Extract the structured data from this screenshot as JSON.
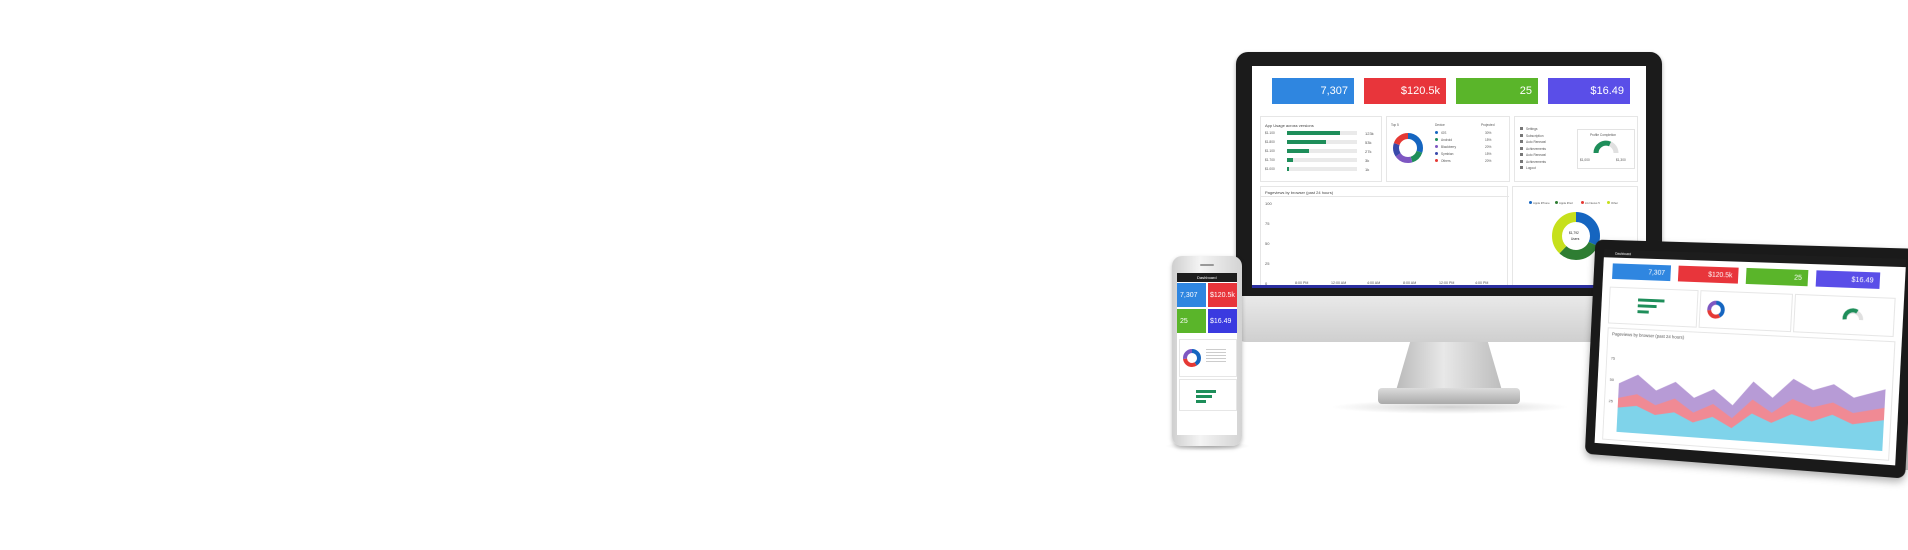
{
  "colors": {
    "blue": "#2f86e0",
    "red": "#e8353b",
    "green": "#5ab52a",
    "purple": "#5a4ee8",
    "bar_green": "#1e8e5a"
  },
  "monitor": {
    "tiles": [
      "7,307",
      "$120.5k",
      "25",
      "$16.49"
    ],
    "app_usage": {
      "title": "App Usage across versions",
      "rows": [
        {
          "label": "$1.100",
          "value": "123k",
          "fill": 0.75
        },
        {
          "label": "$1.800",
          "value": "53k",
          "fill": 0.55
        },
        {
          "label": "$1.100",
          "value": "27k",
          "fill": 0.32
        },
        {
          "label": "$1.700",
          "value": "3k",
          "fill": 0.08
        },
        {
          "label": "$1.000",
          "value": "1k",
          "fill": 0.03
        }
      ]
    },
    "platforms": {
      "headers": [
        "Top 5",
        "Device",
        "Projected"
      ],
      "rows": [
        {
          "name": "iOS",
          "value": "30%",
          "color": "#1565c0"
        },
        {
          "name": "Android",
          "value": "15%",
          "color": "#1e8e5a"
        },
        {
          "name": "Blackberry",
          "value": "20%",
          "color": "#7e57c2"
        },
        {
          "name": "Symbian",
          "value": "15%",
          "color": "#3949ab"
        },
        {
          "name": "Others",
          "value": "20%",
          "color": "#e53935"
        }
      ]
    },
    "settings_menu": [
      "Settings",
      "Subscription",
      "Auto Renewal",
      "Achievements",
      "Auto Renewal",
      "Achievements",
      "Logout"
    ],
    "profile": {
      "title": "Profile Completion",
      "min": "$1,000",
      "max": "$1,300"
    },
    "pageviews": {
      "title": "Pageviews by browser (past 24 hours)",
      "y_ticks": [
        "100",
        "75",
        "50",
        "25",
        "0"
      ],
      "x_ticks": [
        "8:00 PM",
        "12:00 AM",
        "4:00 AM",
        "8:00 AM",
        "12:00 PM",
        "4:00 PM"
      ]
    },
    "browser_donut": {
      "legend": [
        "Apple iPhone",
        "Apple iPad",
        "LG Nexus 5",
        "Other"
      ],
      "center_value": "$1,792",
      "center_label": "Users"
    }
  },
  "phone": {
    "header": "Dashboard",
    "tiles": [
      "7,307",
      "$120.5k",
      "25",
      "$16.49"
    ]
  },
  "tablet": {
    "header": "Dashboard",
    "tiles": [
      "7,307",
      "$120.5k",
      "25",
      "$16.49"
    ],
    "chart_title": "Pageviews by browser (past 24 hours)",
    "y_ticks": [
      "75",
      "50",
      "25"
    ]
  }
}
